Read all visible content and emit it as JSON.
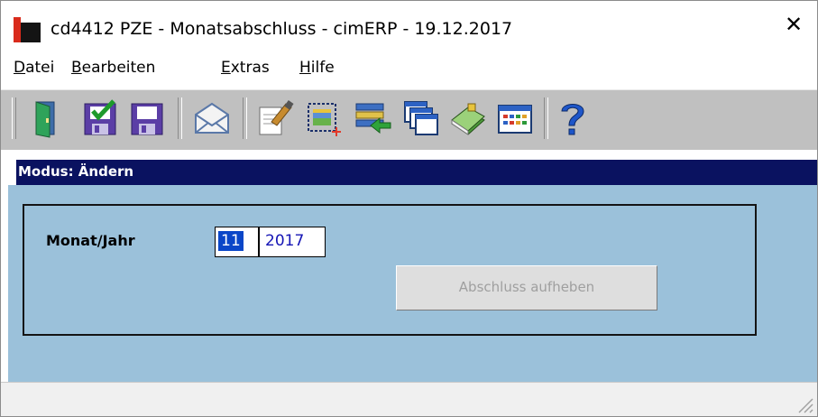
{
  "window": {
    "title": "cd4412 PZE - Monatsabschluss - cimERP - 19.12.2017",
    "close_symbol": "✕"
  },
  "menu": [
    {
      "accel": "D",
      "rest": "atei"
    },
    {
      "accel": "B",
      "rest": "earbeiten"
    },
    {
      "accel": "E",
      "rest": "xtras"
    },
    {
      "accel": "H",
      "rest": "ilfe"
    }
  ],
  "toolbar": {
    "icons": [
      "exit-door-icon",
      "save-and-check-icon",
      "save-icon",
      "mail-envelope-icon",
      "edit-document-icon",
      "new-record-icon",
      "transfer-records-icon",
      "windows-icon",
      "book-icon",
      "calendar-icon",
      "help-question-icon"
    ]
  },
  "mode": {
    "text": "Modus: Ändern"
  },
  "form": {
    "month_year_label": "Monat/Jahr",
    "month": "11",
    "year": "2017",
    "undo_close_button": "Abschluss aufheben"
  },
  "colors": {
    "mode_bar": "#0a1260",
    "workspace": "#9bc1da",
    "toolbar": "#c0c0c0",
    "selection": "#0a46c8",
    "field_text": "#1515b5"
  }
}
